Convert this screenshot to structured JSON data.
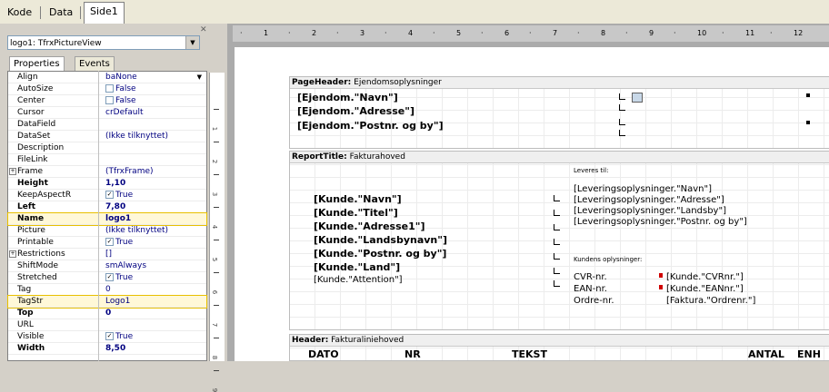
{
  "top_tabs": [
    "Kode",
    "Data",
    "Side1"
  ],
  "object_selector": "logo1: TfrxPictureView",
  "panel_tabs": [
    "Properties",
    "Events"
  ],
  "properties": [
    {
      "name": "Align",
      "value": "baNone",
      "dropdown": true
    },
    {
      "name": "AutoSize",
      "value": "False",
      "checkbox": false
    },
    {
      "name": "Center",
      "value": "False",
      "checkbox": false
    },
    {
      "name": "Cursor",
      "value": "crDefault"
    },
    {
      "name": "DataField",
      "value": ""
    },
    {
      "name": "DataSet",
      "value": "(Ikke tilknyttet)"
    },
    {
      "name": "Description",
      "value": ""
    },
    {
      "name": "FileLink",
      "value": ""
    },
    {
      "name": "Frame",
      "value": "(TfrxFrame)",
      "expander": true
    },
    {
      "name": "Height",
      "value": "1,10",
      "bold": true
    },
    {
      "name": "KeepAspectR",
      "value": "True",
      "checkbox": true
    },
    {
      "name": "Left",
      "value": "7,80",
      "bold": true
    },
    {
      "name": "Name",
      "value": "logo1",
      "bold": true,
      "highlight": true
    },
    {
      "name": "Picture",
      "value": "(Ikke tilknyttet)"
    },
    {
      "name": "Printable",
      "value": "True",
      "checkbox": true
    },
    {
      "name": "Restrictions",
      "value": "[]",
      "expander": true
    },
    {
      "name": "ShiftMode",
      "value": "smAlways"
    },
    {
      "name": "Stretched",
      "value": "True",
      "checkbox": true
    },
    {
      "name": "Tag",
      "value": "0"
    },
    {
      "name": "TagStr",
      "value": "Logo1",
      "highlight": true
    },
    {
      "name": "Top",
      "value": "0",
      "bold": true
    },
    {
      "name": "URL",
      "value": ""
    },
    {
      "name": "Visible",
      "value": "True",
      "checkbox": true
    },
    {
      "name": "Width",
      "value": "8,50",
      "bold": true
    }
  ],
  "ruler_numbers": [
    "1",
    "2",
    "3",
    "4",
    "5",
    "6",
    "7",
    "8",
    "9",
    "10",
    "11",
    "12"
  ],
  "vruler_numbers": [
    "1",
    "2",
    "3",
    "4",
    "5",
    "6",
    "7",
    "8",
    "9"
  ],
  "bands": {
    "page_header": {
      "label": "PageHeader:",
      "name": "Ejendomsoplysninger",
      "fields": [
        "[Ejendom.\"Navn\"]",
        "[Ejendom.\"Adresse\"]",
        "[Ejendom.\"Postnr. og by\"]"
      ]
    },
    "report_title": {
      "label": "ReportTitle:",
      "name": "Fakturahoved",
      "customer_fields": [
        "[Kunde.\"Navn\"]",
        "[Kunde.\"Titel\"]",
        "[Kunde.\"Adresse1\"]",
        "[Kunde.\"Landsbynavn\"]",
        "[Kunde.\"Postnr. og by\"]",
        "[Kunde.\"Land\"]"
      ],
      "attention_field": "[Kunde.\"Attention\"]",
      "delivery_caption": "Leveres til:",
      "delivery_fields": [
        "[Leveringsoplysninger.\"Navn\"]",
        "[Leveringsoplysninger.\"Adresse\"]",
        "[Leveringsoplysninger.\"Landsby\"]",
        "[Leveringsoplysninger.\"Postnr. og by\"]"
      ],
      "customer_info_caption": "Kundens oplysninger:",
      "info_labels": [
        "CVR-nr.",
        "EAN-nr.",
        "Ordre-nr."
      ],
      "info_values": [
        "[Kunde.\"CVRnr.\"]",
        "[Kunde.\"EANnr.\"]",
        "[Faktura.\"Ordrenr.\"]"
      ]
    },
    "header": {
      "label": "Header:",
      "name": "Fakturaliniehoved",
      "columns": [
        "DATO",
        "NR",
        "TEKST",
        "ANTAL",
        "ENH"
      ]
    }
  }
}
